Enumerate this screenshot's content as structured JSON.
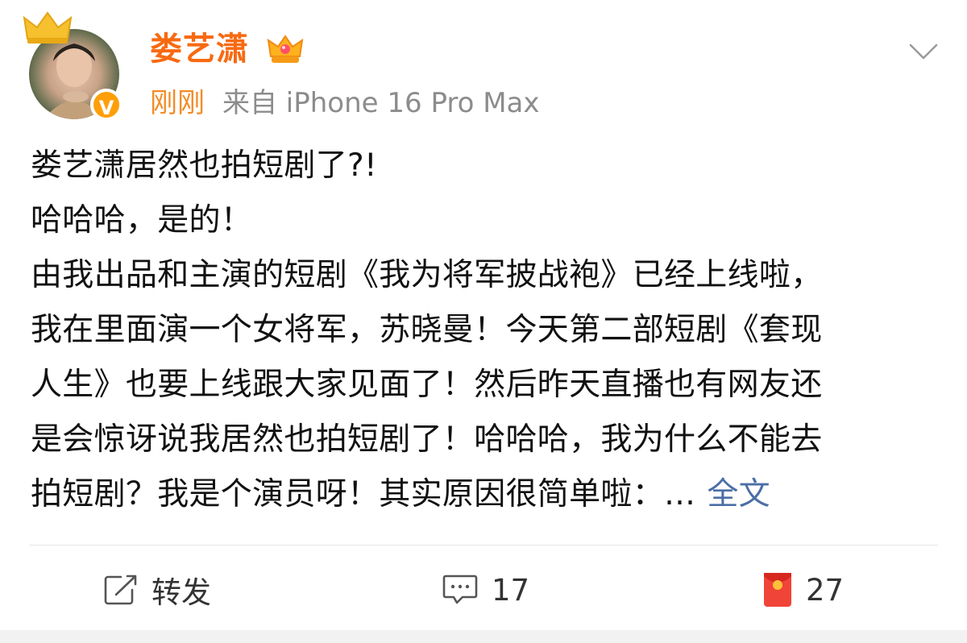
{
  "post": {
    "username": "娄艺潇",
    "time": "刚刚",
    "source": "来自 iPhone 16 Pro Max",
    "verified_mark": "V",
    "icons": {
      "crown_badge": "crown-badge-icon",
      "vip": "vip-crown-icon",
      "verified": "verified-badge-icon",
      "dropdown": "chevron-down-icon"
    },
    "lines": [
      "娄艺潇居然也拍短剧了?!",
      "哈哈哈，是的！",
      "由我出品和主演的短剧《我为将军披战袍》已经上线啦，",
      "我在里面演一个女将军，苏晓曼！今天第二部短剧《套现",
      "人生》也要上线跟大家见面了！然后昨天直播也有网友还",
      "是会惊讶说我居然也拍短剧了！哈哈哈，我为什么不能去",
      "拍短剧？我是个演员呀！其实原因很简单啦：…"
    ],
    "more_link": "全文"
  },
  "actions": {
    "repost_label": "转发",
    "comment_count": "17",
    "like_count": "27"
  },
  "colors": {
    "username": "#f86a12",
    "time": "#f28c28",
    "link": "#4b6ea6",
    "verified": "#ff9f0a"
  }
}
